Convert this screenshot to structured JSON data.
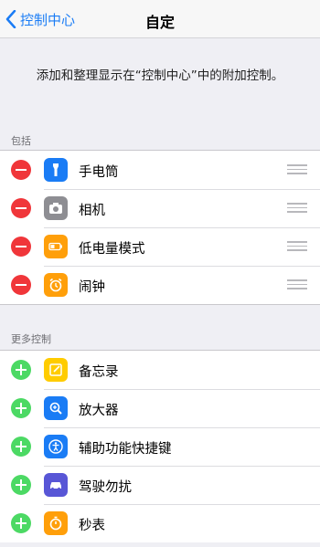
{
  "nav": {
    "back_label": "控制中心",
    "title": "自定"
  },
  "description": "添加和整理显示在“控制中心”中的附加控制。",
  "included": {
    "header": "包括",
    "items": [
      {
        "label": "手电筒",
        "icon": "flashlight-icon",
        "color": "#1a7cf5"
      },
      {
        "label": "相机",
        "icon": "camera-icon",
        "color": "#8e8e93"
      },
      {
        "label": "低电量模式",
        "icon": "battery-icon",
        "color": "#ff9f0a"
      },
      {
        "label": "闹钟",
        "icon": "alarm-icon",
        "color": "#ff9f0a"
      }
    ]
  },
  "more": {
    "header": "更多控制",
    "items": [
      {
        "label": "备忘录",
        "icon": "notes-icon",
        "color": "#ffcc00"
      },
      {
        "label": "放大器",
        "icon": "magnifier-icon",
        "color": "#1a7cf5"
      },
      {
        "label": "辅助功能快捷键",
        "icon": "accessibility-icon",
        "color": "#1a7cf5"
      },
      {
        "label": "驾驶勿扰",
        "icon": "car-icon",
        "color": "#5856d6"
      },
      {
        "label": "秒表",
        "icon": "stopwatch-icon",
        "color": "#ff9f0a"
      }
    ]
  }
}
